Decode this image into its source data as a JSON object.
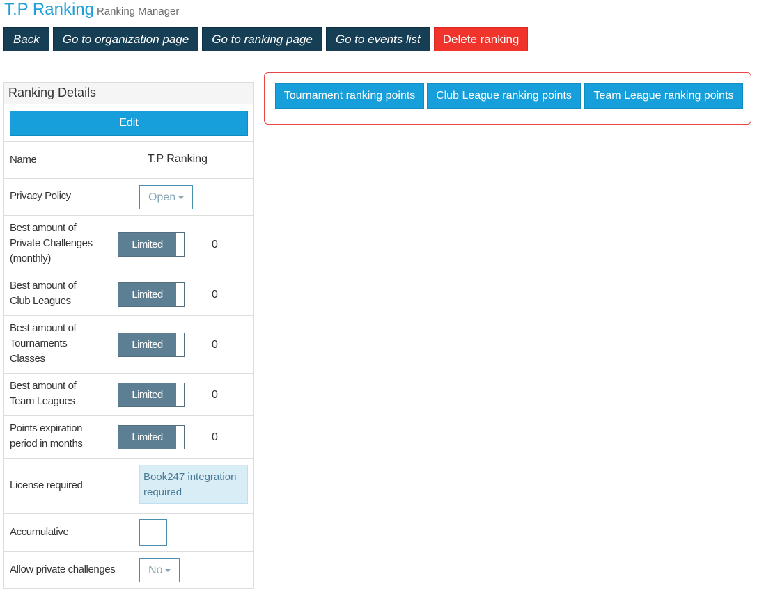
{
  "header": {
    "title": "T.P Ranking",
    "subtitle": "Ranking Manager"
  },
  "top_buttons": {
    "back": "Back",
    "organization": "Go to organization page",
    "ranking": "Go to ranking page",
    "events": "Go to events list",
    "delete": "Delete ranking"
  },
  "panel": {
    "heading": "Ranking Details",
    "edit_label": "Edit",
    "name": {
      "label": "Name",
      "value": "T.P Ranking"
    },
    "privacy": {
      "label": "Privacy Policy",
      "value": "Open"
    },
    "private_challenges": {
      "label": "Best amount of Private Challenges (monthly)",
      "toggle": "Limited",
      "value": "0"
    },
    "club_leagues": {
      "label": "Best amount of Club Leagues",
      "toggle": "Limited",
      "value": "0"
    },
    "tournaments": {
      "label": "Best amount of Tournaments Classes",
      "toggle": "Limited",
      "value": "0"
    },
    "team_leagues": {
      "label": "Best amount of Team Leagues",
      "toggle": "Limited",
      "value": "0"
    },
    "expiration": {
      "label": "Points expiration period in months",
      "toggle": "Limited",
      "value": "0"
    },
    "license": {
      "label": "License required",
      "value": "Book247 integration required"
    },
    "accumulative": {
      "label": "Accumulative",
      "checked": false
    },
    "allow_private": {
      "label": "Allow private challenges",
      "value": "No"
    }
  },
  "points_buttons": {
    "tournament": "Tournament ranking points",
    "club_league": "Club League ranking points",
    "team_league": "Team League ranking points"
  },
  "colors": {
    "title_blue": "#1f9fd9",
    "dark_button": "#163f55",
    "danger_button": "#f0332b",
    "primary_button": "#169fdb",
    "toggle_on": "#5d7f93",
    "highlight_border": "#e84545"
  }
}
